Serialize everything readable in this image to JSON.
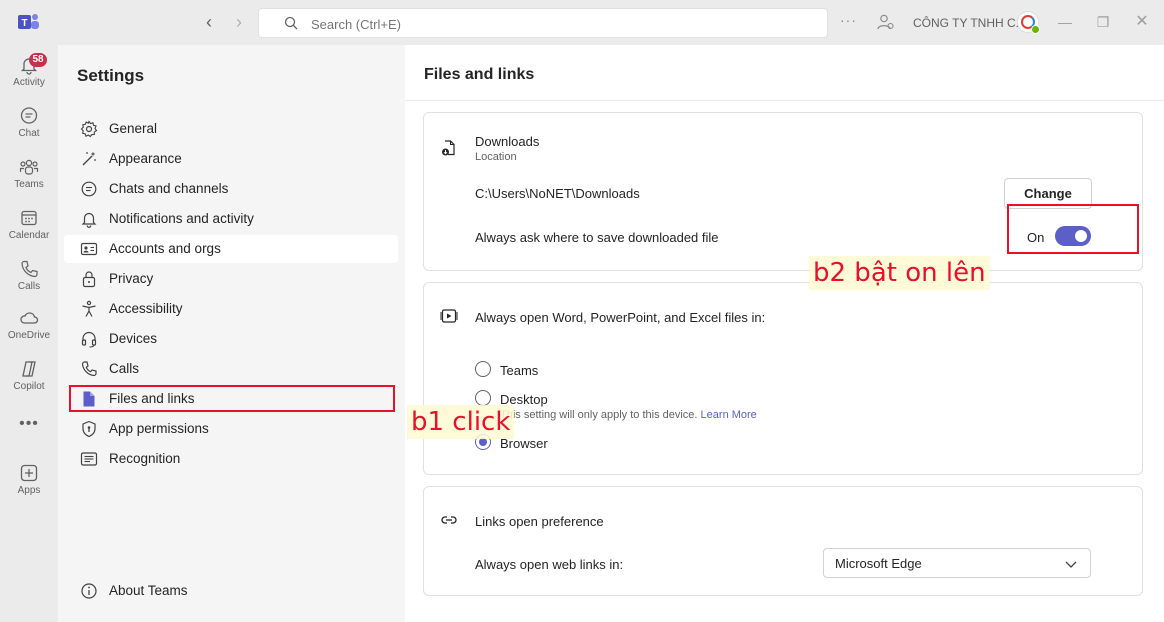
{
  "titlebar": {
    "search_placeholder": "Search (Ctrl+E)",
    "org_name": "CÔNG TY TNHH C..."
  },
  "rail": {
    "activity": "Activity",
    "activity_badge": "58",
    "chat": "Chat",
    "teams": "Teams",
    "calendar": "Calendar",
    "calls": "Calls",
    "onedrive": "OneDrive",
    "copilot": "Copilot",
    "apps": "Apps"
  },
  "settings": {
    "title": "Settings",
    "items": [
      {
        "label": "General",
        "icon": "gear-icon"
      },
      {
        "label": "Appearance",
        "icon": "wand-icon"
      },
      {
        "label": "Chats and channels",
        "icon": "chat-bubble-icon"
      },
      {
        "label": "Notifications and activity",
        "icon": "bell-icon"
      },
      {
        "label": "Accounts and orgs",
        "icon": "contact-card-icon"
      },
      {
        "label": "Privacy",
        "icon": "lock-icon"
      },
      {
        "label": "Accessibility",
        "icon": "accessibility-icon"
      },
      {
        "label": "Devices",
        "icon": "headset-icon"
      },
      {
        "label": "Calls",
        "icon": "phone-icon"
      },
      {
        "label": "Files and links",
        "icon": "document-icon"
      },
      {
        "label": "App permissions",
        "icon": "shield-icon"
      },
      {
        "label": "Recognition",
        "icon": "recognition-icon"
      }
    ],
    "about": "About Teams"
  },
  "main": {
    "title": "Files and links",
    "downloads": {
      "heading": "Downloads",
      "sub": "Location",
      "path": "C:\\Users\\NoNET\\Downloads",
      "change_label": "Change",
      "ask_label": "Always ask where to save downloaded file",
      "toggle_state": "On"
    },
    "open_files": {
      "heading": "Always open Word, PowerPoint, and Excel files in:",
      "options": [
        "Teams",
        "Desktop",
        "Browser"
      ],
      "selected": "Browser",
      "note": "This setting will only apply to this device.",
      "learn_more": "Learn More"
    },
    "links": {
      "heading": "Links open preference",
      "label": "Always open web links in:",
      "selected": "Microsoft Edge"
    }
  },
  "annotations": {
    "step1": "b1 click",
    "step2": "b2 bật on lên"
  },
  "colors": {
    "accent": "#5b5fc7",
    "annotation": "#e8102b",
    "badge": "#c4314b"
  }
}
